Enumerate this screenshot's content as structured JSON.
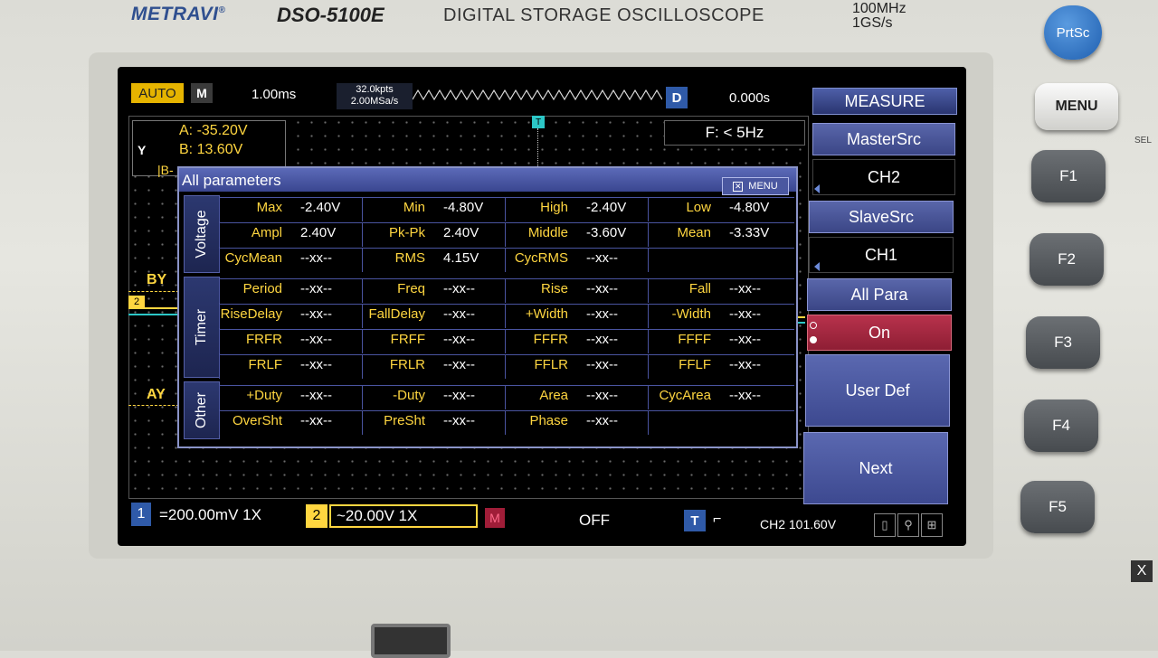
{
  "device": {
    "brand": "METRAVI",
    "brand_mark": "®",
    "model": "DSO-5100E",
    "title": "DIGITAL STORAGE OSCILLOSCOPE",
    "spec_bandwidth": "100MHz",
    "spec_samplerate": "1GS/s"
  },
  "hardware_buttons": {
    "prtsc": "PrtSc",
    "menu": "MENU",
    "sel": "SEL",
    "f1": "F1",
    "f2": "F2",
    "f3": "F3",
    "f4": "F4",
    "f5": "F5",
    "close_glyph": "X"
  },
  "status_bar": {
    "mode": "AUTO",
    "m_badge": "M",
    "timebase": "1.00ms",
    "mem_depth": "32.0kpts",
    "sample_rate": "2.00MSa/s",
    "d_badge": "D",
    "trigger_position": "0.000s",
    "menu_title": "MEASURE"
  },
  "frequency_readout": "F: < 5Hz",
  "cursors": {
    "y_label": "Y",
    "a_value": "A: -35.20V",
    "b_value": "B: 13.60V",
    "b_partial": "|B-",
    "by_label": "BY",
    "ay_label": "AY"
  },
  "markers": {
    "ch2_marker": "2",
    "trigger_marker": "T"
  },
  "dialog": {
    "title": "All parameters",
    "menu_button": "MENU",
    "groups": {
      "voltage": "Voltage",
      "timer": "Timer",
      "other": "Other"
    },
    "voltage": {
      "r1": [
        {
          "label": "Max",
          "value": "-2.40V"
        },
        {
          "label": "Min",
          "value": "-4.80V"
        },
        {
          "label": "High",
          "value": "-2.40V"
        },
        {
          "label": "Low",
          "value": "-4.80V"
        }
      ],
      "r2": [
        {
          "label": "Ampl",
          "value": "2.40V"
        },
        {
          "label": "Pk-Pk",
          "value": "2.40V"
        },
        {
          "label": "Middle",
          "value": "-3.60V"
        },
        {
          "label": "Mean",
          "value": "-3.33V"
        }
      ],
      "r3": [
        {
          "label": "CycMean",
          "value": "--xx--"
        },
        {
          "label": "RMS",
          "value": "4.15V"
        },
        {
          "label": "CycRMS",
          "value": "--xx--"
        }
      ]
    },
    "timer": {
      "r1": [
        {
          "label": "Period",
          "value": "--xx--"
        },
        {
          "label": "Freq",
          "value": "--xx--"
        },
        {
          "label": "Rise",
          "value": "--xx--"
        },
        {
          "label": "Fall",
          "value": "--xx--"
        }
      ],
      "r2": [
        {
          "label": "RiseDelay",
          "value": "--xx--"
        },
        {
          "label": "FallDelay",
          "value": "--xx--"
        },
        {
          "label": "+Width",
          "value": "--xx--"
        },
        {
          "label": "-Width",
          "value": "--xx--"
        }
      ],
      "r3": [
        {
          "label": "FRFR",
          "value": "--xx--"
        },
        {
          "label": "FRFF",
          "value": "--xx--"
        },
        {
          "label": "FFFR",
          "value": "--xx--"
        },
        {
          "label": "FFFF",
          "value": "--xx--"
        }
      ],
      "r4": [
        {
          "label": "FRLF",
          "value": "--xx--"
        },
        {
          "label": "FRLR",
          "value": "--xx--"
        },
        {
          "label": "FFLR",
          "value": "--xx--"
        },
        {
          "label": "FFLF",
          "value": "--xx--"
        }
      ]
    },
    "other": {
      "r1": [
        {
          "label": "+Duty",
          "value": "--xx--"
        },
        {
          "label": "-Duty",
          "value": "--xx--"
        },
        {
          "label": "Area",
          "value": "--xx--"
        },
        {
          "label": "CycArea",
          "value": "--xx--"
        }
      ],
      "r2": [
        {
          "label": "OverSht",
          "value": "--xx--"
        },
        {
          "label": "PreSht",
          "value": "--xx--"
        },
        {
          "label": "Phase",
          "value": "--xx--"
        }
      ]
    }
  },
  "softkeys": {
    "master_src_label": "MasterSrc",
    "master_src_value": "CH2",
    "slave_src_label": "SlaveSrc",
    "slave_src_value": "CH1",
    "all_para_label": "All Para",
    "all_para_value": "On",
    "user_def": "User Def",
    "next": "Next"
  },
  "bottom_bar": {
    "ch1_num": "1",
    "ch1_scale": "=200.00mV 1X",
    "ch2_num": "2",
    "ch2_scale": "~20.00V 1X",
    "math_badge": "M",
    "math_state": "OFF",
    "trig_badge": "T",
    "trig_edge": "⌐",
    "trig_level": "CH2 101.60V"
  },
  "colors": {
    "channel2": "#ffd640",
    "channel1": "#2cc7c7",
    "menu_blue": "#3b4686",
    "on_red": "#b8324c"
  }
}
